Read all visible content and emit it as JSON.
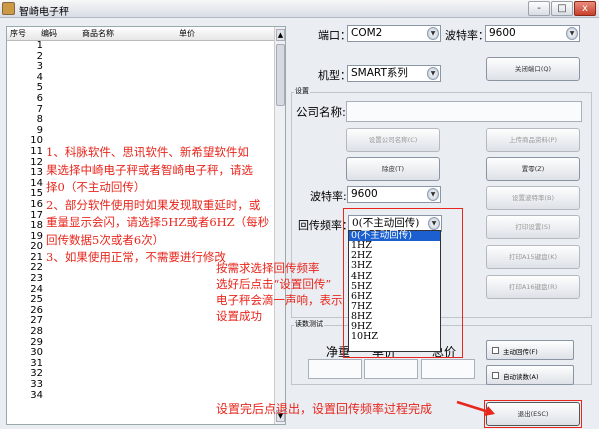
{
  "window": {
    "title": "智崎电子秤",
    "min": "-",
    "max": "□",
    "close": "x"
  },
  "list": {
    "headers": [
      "序号",
      "编码",
      "商品名称",
      "单价"
    ],
    "row_numbers": [
      "1",
      "2",
      "3",
      "4",
      "5",
      "6",
      "7",
      "8",
      "9",
      "10",
      "11",
      "12",
      "13",
      "14",
      "15",
      "16",
      "17",
      "18",
      "19",
      "20",
      "21",
      "22",
      "23",
      "24",
      "25",
      "26",
      "27",
      "28",
      "29",
      "30",
      "31",
      "32",
      "33",
      "34"
    ]
  },
  "notes": {
    "left": [
      "1、科脉软件、思讯软件、新希望软件如",
      "果选择中崎电子秤或者智崎电子秤，请选",
      "择0（不主动回传）",
      "2、部分软件使用时如果发现取重延时，或",
      "重量显示会闪，请选择5HZ或者6HZ（每秒",
      "回传数据5次或者6次）",
      "3、如果使用正常，不需要进行修改"
    ],
    "middle": [
      "按需求选择回传频率",
      "选好后点击“设置回传”",
      "电子秤会滴一声响，表示",
      "设置成功"
    ],
    "bottom": "设置完后点退出，设置回传频率过程完成"
  },
  "port": {
    "label": "端口：",
    "value": "COM2"
  },
  "baud_top": {
    "label": "波特率：",
    "value": "9600"
  },
  "model": {
    "label": "机型：",
    "value": "SMART系列"
  },
  "close_port_button": "关闭端口(Q)",
  "settings": {
    "caption": "设置",
    "company_label": "公司名称:",
    "set_company_button": "设置公司名称(C)",
    "upload_button": "上传商品资料(P)",
    "tare_button": "除皮(T)",
    "zero_button": "置零(Z)",
    "baud_label": "波特率:",
    "baud_value": "9600",
    "set_baud_button": "设置波特率(B)",
    "return_freq_label": "回传频率：",
    "return_freq_value": "0(不主动回传)",
    "print_setup_button": "打印设置(S)",
    "print_a15_button": "打印A15键盘(K)",
    "print_a16_button": "打印A16键盘(R)"
  },
  "freq_options": [
    "0(不主动回传)",
    "1HZ",
    "2HZ",
    "3HZ",
    "4HZ",
    "5HZ",
    "6HZ",
    "7HZ",
    "8HZ",
    "9HZ",
    "10HZ"
  ],
  "read_test": {
    "caption": "读数测试",
    "net_label": "净重",
    "price_label": "单价",
    "total_label": "总价",
    "auto_return_label": "主动回传(F)",
    "auto_read_label": "自动读数(A)"
  },
  "exit_button": "退出(ESC)",
  "colors": {
    "annotation": "#e8261c",
    "selection": "#1b5fd1"
  }
}
